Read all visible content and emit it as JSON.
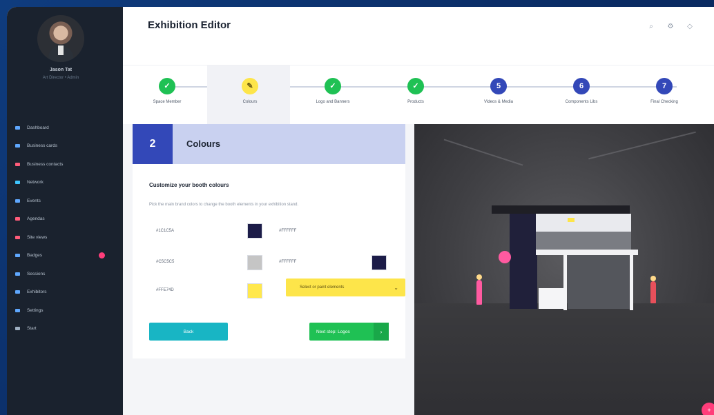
{
  "user": {
    "name": "Jason Tat",
    "role": "Art Director • Admin"
  },
  "sidebar": {
    "items": [
      {
        "label": "Dashboard",
        "icon": "dashboard-icon",
        "color": "#5fa8ff"
      },
      {
        "label": "Business cards",
        "icon": "card-icon",
        "color": "#5fa8ff"
      },
      {
        "label": "Business contacts",
        "icon": "contacts-icon",
        "color": "#ff5c7a"
      },
      {
        "label": "Network",
        "icon": "network-icon",
        "color": "#3ec6ff"
      },
      {
        "label": "Events",
        "icon": "events-icon",
        "color": "#5fa8ff"
      },
      {
        "label": "Agendas",
        "icon": "agenda-icon",
        "color": "#ff5c7a"
      },
      {
        "label": "Site views",
        "icon": "views-icon",
        "color": "#ff5c7a"
      },
      {
        "label": "Badges",
        "icon": "badge-icon",
        "color": "#5fa8ff"
      },
      {
        "label": "Sessions",
        "icon": "sessions-icon",
        "color": "#5fa8ff"
      },
      {
        "label": "Exhibitors",
        "icon": "exhibitors-icon",
        "color": "#5fa8ff"
      },
      {
        "label": "Settings",
        "icon": "settings-icon",
        "color": "#5fa8ff"
      },
      {
        "label": "Start",
        "icon": "start-icon",
        "color": "#9fb0c2"
      }
    ]
  },
  "header": {
    "title": "Exhibition Editor",
    "icons": [
      "search-icon",
      "settings-icon",
      "notification-icon"
    ]
  },
  "stepper": {
    "steps": [
      {
        "label": "Space Member",
        "state": "done",
        "symbol": "✓",
        "color": "#1fc154"
      },
      {
        "label": "Colours",
        "state": "active",
        "symbol": "✎",
        "color": "#fde54a"
      },
      {
        "label": "Logo and Banners",
        "state": "done",
        "symbol": "✓",
        "color": "#1fc154"
      },
      {
        "label": "Products",
        "state": "done",
        "symbol": "✓",
        "color": "#1fc154"
      },
      {
        "label": "Videos & Media",
        "state": "pending",
        "symbol": "5",
        "color": "#3348b8"
      },
      {
        "label": "Components Libs",
        "state": "pending",
        "symbol": "6",
        "color": "#3348b8"
      },
      {
        "label": "Final Checking",
        "state": "pending",
        "symbol": "7",
        "color": "#3348b8"
      }
    ]
  },
  "panel": {
    "number": "2",
    "title": "Colours",
    "section_title": "Customize your booth colours",
    "section_desc": "Pick the main brand colors to change the booth elements in your exhibition stand.",
    "colors": [
      {
        "label": "#1C1C5A",
        "swatch": "#1c1c48"
      },
      {
        "label": "#FFFFFF",
        "swatch": "#ffffff"
      },
      {
        "label": "#C5C5C5",
        "swatch": "#c5c5c5"
      },
      {
        "label": "#FFFFFF",
        "swatch": "#1c1c48"
      },
      {
        "label": "#FFE74D",
        "swatch": "#ffe84d"
      }
    ],
    "select_text": "Select or paint elements",
    "back_label": "Back",
    "next_label": "Next step: Logos"
  },
  "preview": {
    "badge": "+"
  }
}
